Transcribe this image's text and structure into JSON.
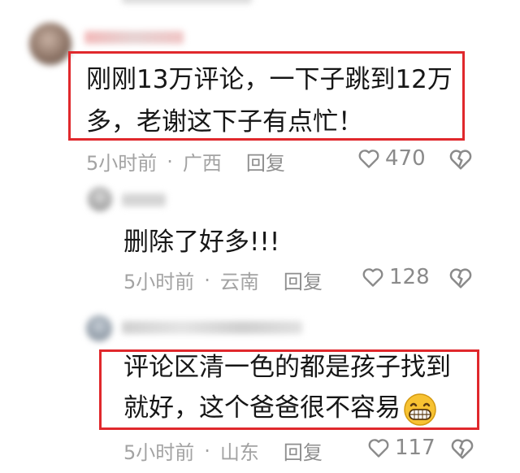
{
  "comments": [
    {
      "text_line1": "刚刚13万评论，一下子跳到12万",
      "text_line2": "多，老谢这下子有点忙！",
      "time": "5小时前",
      "sep": "·",
      "region": "广西",
      "reply": "回复",
      "likes": "470"
    },
    {
      "text_line1": "删除了好多!!!",
      "time": "5小时前",
      "sep": "·",
      "region": "云南",
      "reply": "回复",
      "likes": "128"
    },
    {
      "text_line1": "评论区清一色的都是孩子找到",
      "text_line2": "就好，这个爸爸很不容易",
      "time": "5小时前",
      "sep": "·",
      "region": "山东",
      "reply": "回复",
      "likes": "117"
    }
  ],
  "icons": {
    "like": "heart-outline-icon",
    "dislike": "broken-heart-icon",
    "emoji": "grinning-face-icon"
  },
  "colors": {
    "highlight_box": "#e0282c",
    "meta_text": "#a3a3a3"
  }
}
